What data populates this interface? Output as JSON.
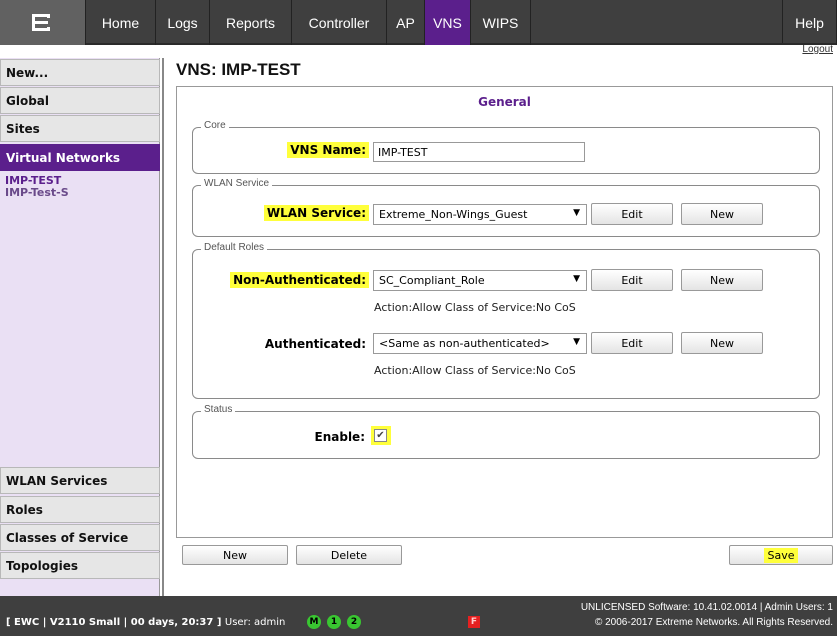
{
  "nav": {
    "logo": "extreme-networks-logo",
    "items": [
      {
        "label": "Home"
      },
      {
        "label": "Logs"
      },
      {
        "label": "Reports"
      },
      {
        "label": "Controller"
      },
      {
        "label": "AP"
      },
      {
        "label": "VNS",
        "active": true
      },
      {
        "label": "WIPS"
      }
    ],
    "help": "Help",
    "logout": "Logout"
  },
  "sidebar": {
    "top": [
      "New...",
      "Global",
      "Sites",
      "Virtual Networks"
    ],
    "vns_list": [
      "IMP-TEST",
      "IMP-Test-S"
    ],
    "bottom": [
      "WLAN Services",
      "Roles",
      "Classes of Service",
      "Topologies"
    ]
  },
  "page": {
    "title": "VNS: IMP-TEST",
    "section_head": "General"
  },
  "core": {
    "legend": "Core",
    "vns_name_label": "VNS Name:",
    "vns_name_value": "IMP-TEST"
  },
  "wlan": {
    "legend": "WLAN Service",
    "label": "WLAN Service:",
    "selected": "Extreme_Non-Wings_Guest",
    "edit": "Edit",
    "new": "New"
  },
  "roles": {
    "legend": "Default Roles",
    "nonauth_label": "Non-Authenticated:",
    "nonauth_selected": "SC_Compliant_Role",
    "nonauth_info": "Action:Allow  Class of Service:No CoS",
    "auth_label": "Authenticated:",
    "auth_selected": "<Same as non-authenticated>",
    "auth_info": "Action:Allow  Class of Service:No CoS",
    "edit": "Edit",
    "new": "New"
  },
  "status": {
    "legend": "Status",
    "enable_label": "Enable:",
    "enabled": true
  },
  "actions": {
    "new": "New",
    "delete": "Delete",
    "save": "Save"
  },
  "footer": {
    "left": "[ EWC | V2110 Small | 00 days, 20:37 ]",
    "user": "User: admin",
    "indicators": [
      "M",
      "1",
      "2"
    ],
    "flag": "F",
    "license": "UNLICENSED Software: 10.41.02.0014 | Admin Users: 1",
    "copyright": "© 2006-2017  Extreme Networks. All Rights Reserved."
  },
  "colors": {
    "accent": "#5b1f8c",
    "highlight": "#ffff3b",
    "bar": "#3f3f3f",
    "status_green": "#39c631"
  }
}
